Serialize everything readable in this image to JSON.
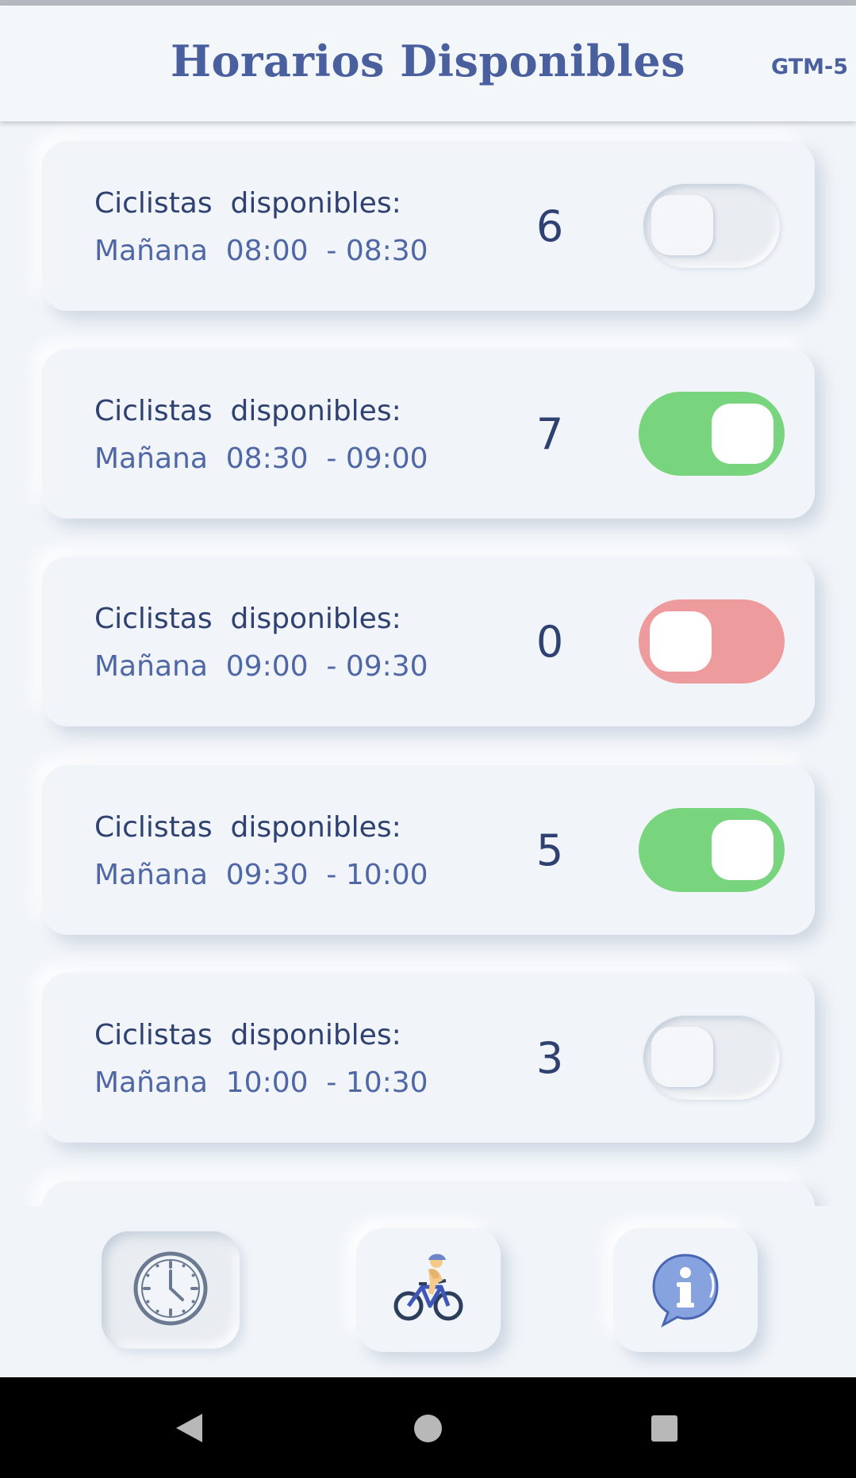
{
  "header": {
    "title": "Horarios Disponibles",
    "timezone": "GTM-5"
  },
  "slots": [
    {
      "label": "Ciclistas  disponibles:",
      "time": "Mañana  08:00  - 08:30",
      "count": "6",
      "toggle": "off"
    },
    {
      "label": "Ciclistas  disponibles:",
      "time": "Mañana  08:30  - 09:00",
      "count": "7",
      "toggle": "on"
    },
    {
      "label": "Ciclistas  disponibles:",
      "time": "Mañana  09:00  - 09:30",
      "count": "0",
      "toggle": "unavailable"
    },
    {
      "label": "Ciclistas  disponibles:",
      "time": "Mañana  09:30  - 10:00",
      "count": "5",
      "toggle": "on"
    },
    {
      "label": "Ciclistas  disponibles:",
      "time": "Mañana  10:00  - 10:30",
      "count": "3",
      "toggle": "off"
    }
  ],
  "colors": {
    "accent": "#4a5f9e",
    "toggle_on": "#79d57d",
    "toggle_unavailable": "#ee9b9d",
    "background": "#f1f5f9"
  },
  "bottom_nav": [
    {
      "icon": "clock-icon",
      "active": true
    },
    {
      "icon": "cyclist-icon",
      "active": false
    },
    {
      "icon": "info-icon",
      "active": false
    }
  ],
  "system_nav": [
    "back-icon",
    "home-icon",
    "recents-icon"
  ]
}
